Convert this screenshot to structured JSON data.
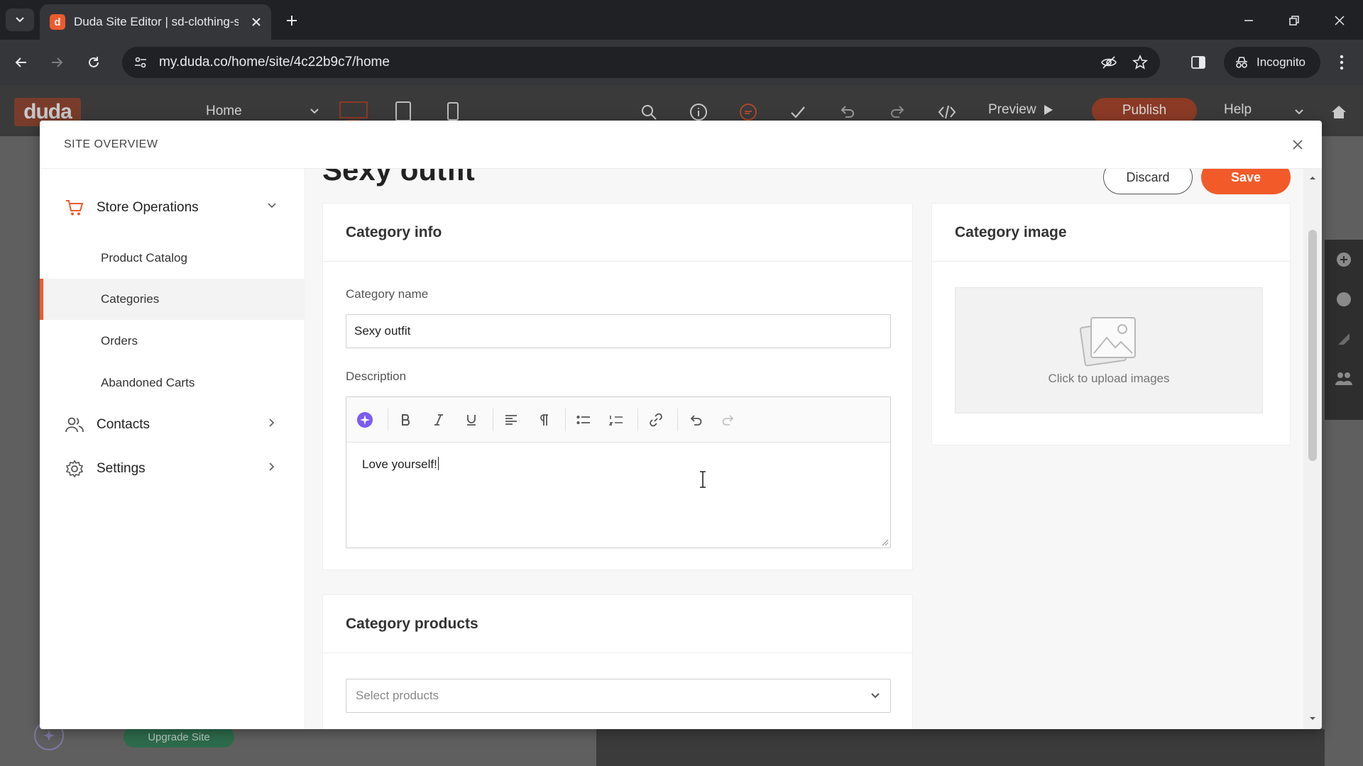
{
  "browser": {
    "tab_title": "Duda Site Editor | sd-clothing-s",
    "url": "my.duda.co/home/site/4c22b9c7/home",
    "profile_label": "Incognito"
  },
  "editor": {
    "logo_text": "duda",
    "page_selector": "Home",
    "preview_label": "Preview",
    "publish_label": "Publish",
    "help_label": "Help",
    "upgrade_label": "Upgrade Site"
  },
  "modal": {
    "title": "SITE OVERVIEW"
  },
  "sidebar": {
    "store_operations": "Store Operations",
    "sub_items": [
      {
        "label": "Product Catalog"
      },
      {
        "label": "Categories"
      },
      {
        "label": "Orders"
      },
      {
        "label": "Abandoned Carts"
      }
    ],
    "contacts": "Contacts",
    "settings": "Settings"
  },
  "page": {
    "heading": "Sexy outfit",
    "discard_label": "Discard",
    "save_label": "Save"
  },
  "category_info": {
    "heading": "Category info",
    "name_label": "Category name",
    "name_value": "Sexy outfit",
    "description_label": "Description",
    "description_value": "Love yourself!"
  },
  "category_image": {
    "heading": "Category image",
    "upload_text": "Click to upload images"
  },
  "category_products": {
    "heading": "Category products",
    "select_placeholder": "Select products"
  },
  "colors": {
    "accent": "#f25a2a",
    "ai_purple": "#7b5cf0"
  }
}
